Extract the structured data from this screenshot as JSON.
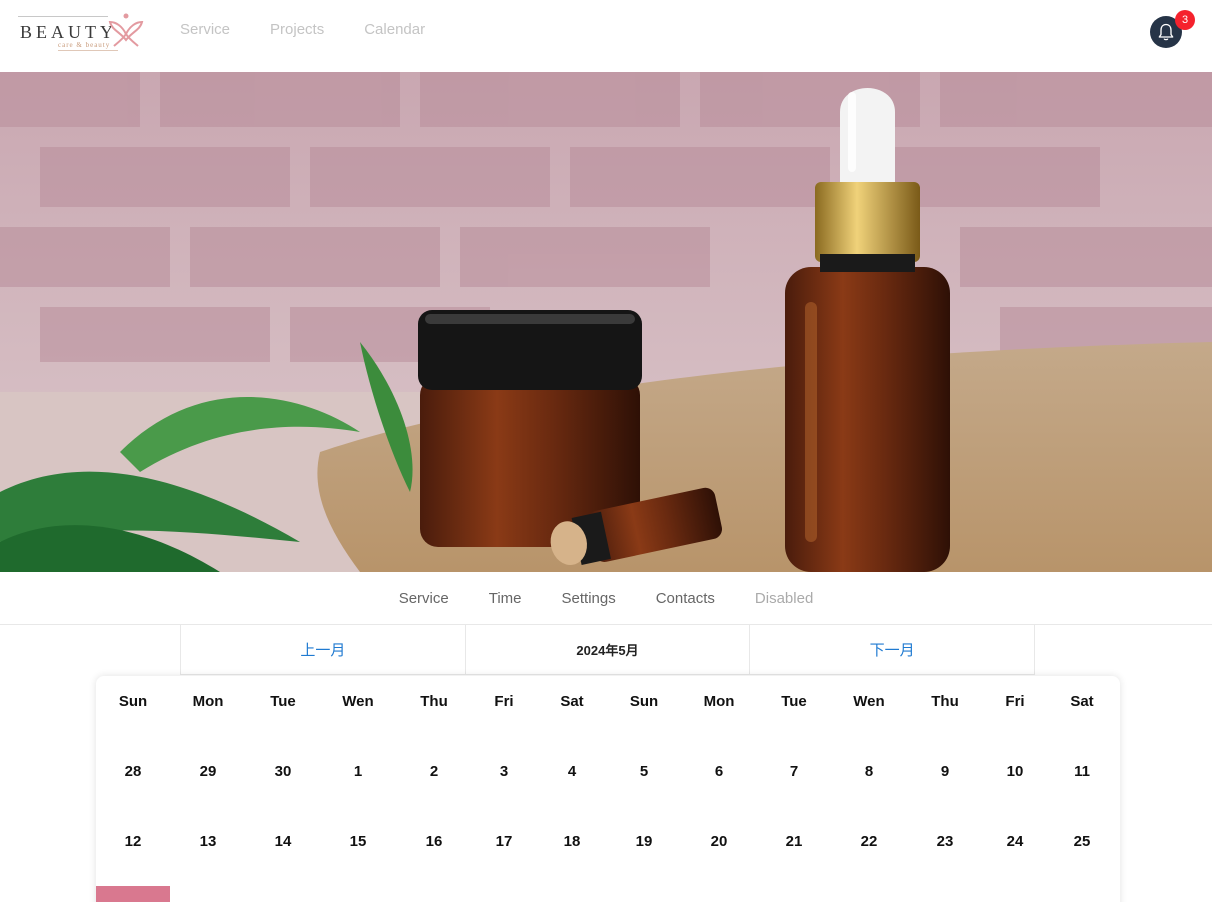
{
  "header": {
    "logo": {
      "text": "BEAUTY",
      "subtext": "care & beauty"
    },
    "nav": [
      "Service",
      "Projects",
      "Calendar"
    ],
    "notifications": {
      "icon": "bell-icon",
      "count": "3"
    }
  },
  "hero": {
    "description_icon": "hero-image"
  },
  "tabs": [
    {
      "label": "Service",
      "disabled": false
    },
    {
      "label": "Time",
      "disabled": false
    },
    {
      "label": "Settings",
      "disabled": false
    },
    {
      "label": "Contacts",
      "disabled": false
    },
    {
      "label": "Disabled",
      "disabled": true
    }
  ],
  "month_switch": {
    "prev": "上一月",
    "current": "2024年5月",
    "next": "下一月"
  },
  "calendar": {
    "weekdays": [
      "Sun",
      "Mon",
      "Tue",
      "Wen",
      "Thu",
      "Fri",
      "Sat",
      "Sun",
      "Mon",
      "Tue",
      "Wen",
      "Thu",
      "Fri",
      "Sat"
    ],
    "weeks": [
      [
        "28",
        "29",
        "30",
        "1",
        "2",
        "3",
        "4",
        "5",
        "6",
        "7",
        "8",
        "9",
        "10",
        "11"
      ],
      [
        "12",
        "13",
        "14",
        "15",
        "16",
        "17",
        "18",
        "19",
        "20",
        "21",
        "22",
        "23",
        "24",
        "25"
      ]
    ]
  },
  "colors": {
    "accent": "#1f7ad1",
    "selected": "#d9788f",
    "badge": "#f5222d",
    "bell_bg": "#263447"
  }
}
